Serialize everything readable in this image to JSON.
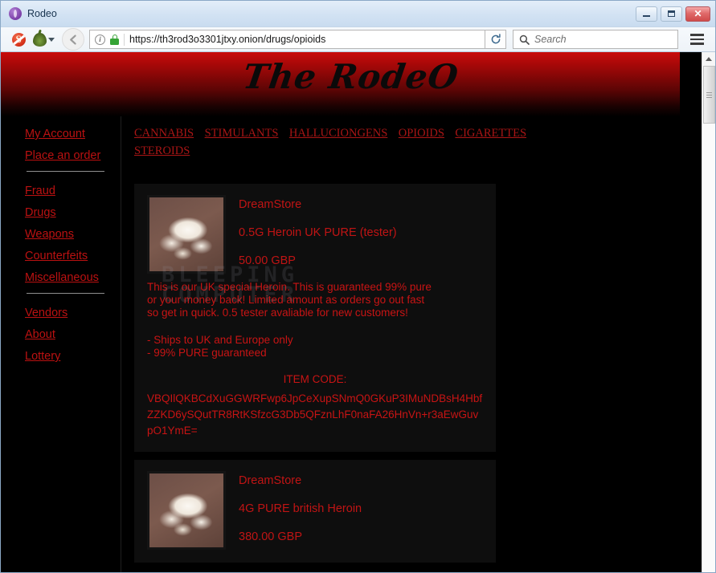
{
  "window": {
    "title": "Rodeo",
    "icon": "onion-browser-icon",
    "controls": {
      "minimize": "",
      "maximize": "",
      "close": "✕"
    }
  },
  "toolbar": {
    "noscript_icon": "noscript-icon",
    "tor_icon": "tor-onion-icon",
    "back_icon": "back-arrow-icon",
    "info_icon": "i",
    "lock_icon": "padlock-icon",
    "url": "https://th3rod3o3301jtxy.onion/drugs/opioids",
    "reload_icon": "reload-icon",
    "search_placeholder": "Search",
    "search_value": "",
    "menu_icon": "hamburger-menu-icon"
  },
  "site": {
    "banner_title": "The RodeO",
    "watermark": "BLEEPING\nCOMPUTER",
    "topnav": [
      {
        "label": "CANNABIS"
      },
      {
        "label": "STIMULANTS"
      },
      {
        "label": "HALLUCIONGENS"
      },
      {
        "label": "OPIOIDS"
      },
      {
        "label": "CIGARETTES"
      },
      {
        "label": "STEROIDS"
      }
    ],
    "sidebar": {
      "group1": [
        {
          "label": "My Account"
        },
        {
          "label": "Place an order"
        }
      ],
      "group2": [
        {
          "label": "Fraud"
        },
        {
          "label": "Drugs"
        },
        {
          "label": "Weapons"
        },
        {
          "label": "Counterfeits"
        },
        {
          "label": "Miscellaneous"
        }
      ],
      "group3": [
        {
          "label": "Vendors"
        },
        {
          "label": "About"
        },
        {
          "label": "Lottery"
        }
      ]
    },
    "listings": [
      {
        "vendor": "DreamStore",
        "name": "0.5G Heroin UK PURE (tester)",
        "price": "50.00 GBP",
        "image": "heroin-powder-photo",
        "description": "This is our UK special Heroin. This is guaranteed 99% pure\nor your money back! Limited amount as orders go out fast\nso get in quick. 0.5 tester avaliable for new customers!",
        "bullets": "- Ships to UK and Europe only\n- 99% PURE guaranteed",
        "code_label": "ITEM CODE:",
        "code_value": "VBQIlQKBCdXuGGWRFwp6JpCeXupSNmQ0GKuP3IMuNDBsH4HbfZZKD6ySQutTR8RtKSfzcG3Db5QFznLhF0naFA26HnVn+r3aEwGuvpO1YmE="
      },
      {
        "vendor": "DreamStore",
        "name": "4G PURE british Heroin",
        "price": "380.00 GBP",
        "image": "heroin-powder-photo"
      }
    ]
  },
  "scrollbar": {
    "up_icon": "scroll-up-arrow-icon"
  },
  "colors": {
    "link_red": "#bb1111",
    "nav_red": "#a81515",
    "text_red": "#c81414",
    "page_bg": "#000000",
    "card_bg": "#0e0e0e",
    "banner_red": "#c90b0b"
  }
}
